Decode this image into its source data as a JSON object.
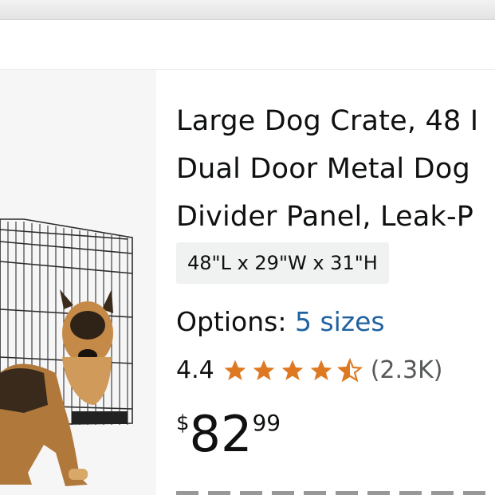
{
  "product": {
    "title_lines": [
      "Large Dog Crate, 48 I",
      "Dual Door Metal Dog",
      "Divider Panel, Leak-P"
    ],
    "dimensions": "48\"L x 29\"W x 31\"H",
    "options_label": "Options:",
    "options_link": "5 sizes",
    "rating_value": "4.4",
    "rating_stars": 4.4,
    "review_count": "(2.3K)",
    "price_symbol": "$",
    "price_whole": "82",
    "price_fraction": "99",
    "image_alt": "Dog sitting in front of a metal wire crate"
  },
  "colors": {
    "link": "#2162a1",
    "star": "#de7921",
    "text": "#0f1111",
    "muted": "#565959",
    "chip": "#f0f2f2"
  },
  "icons": [
    "star-full-icon",
    "star-half-icon"
  ]
}
